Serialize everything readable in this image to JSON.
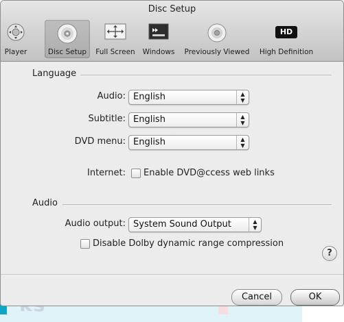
{
  "window": {
    "title": "Disc Setup"
  },
  "toolbar": {
    "items": [
      {
        "label": "Player",
        "icon": "player-icon"
      },
      {
        "label": "Disc Setup",
        "icon": "disc-icon",
        "selected": true
      },
      {
        "label": "Full Screen",
        "icon": "full-screen-icon"
      },
      {
        "label": "Windows",
        "icon": "windows-icon"
      },
      {
        "label": "Previously Viewed",
        "icon": "disc-history-icon"
      },
      {
        "label": "High Definition",
        "icon": "hd-icon",
        "badge": "HD"
      }
    ]
  },
  "language": {
    "heading": "Language",
    "audio_label": "Audio:",
    "audio_value": "English",
    "subtitle_label": "Subtitle:",
    "subtitle_value": "English",
    "dvdmenu_label": "DVD menu:",
    "dvdmenu_value": "English",
    "internet_label": "Internet:",
    "internet_checkbox": "Enable DVD@ccess web links",
    "internet_checked": false
  },
  "audio": {
    "heading": "Audio",
    "output_label": "Audio output:",
    "output_value": "System Sound Output",
    "dolby_checkbox": "Disable Dolby dynamic range compression",
    "dolby_checked": false
  },
  "help": {
    "glyph": "?"
  },
  "buttons": {
    "cancel": "Cancel",
    "ok": "OK"
  }
}
